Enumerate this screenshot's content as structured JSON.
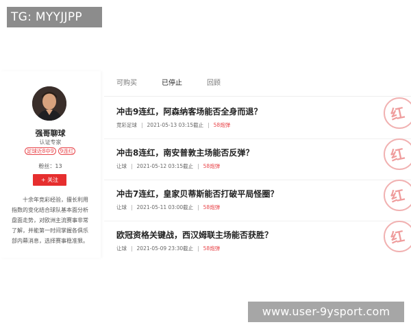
{
  "watermarks": {
    "top_left": "TG: MYYJJPP",
    "bottom_right": "www.user-9ysport.com"
  },
  "author": {
    "name": "强哥聊球",
    "title": "认证专家",
    "tags": [
      "足球近8中9",
      "9连红"
    ],
    "fans": "粉丝：13",
    "follow_label": "+ 关注",
    "bio": "十余年竞彩经验，擅长利用指数的变化结合球队基本面分析盘面走势，对欧洲主流赛事非常了解，并能第一时间掌握各俱乐部内幕消息，选择赛事稳准狠。"
  },
  "tabs": [
    "可购买",
    "已停止",
    "回顾"
  ],
  "active_tab": "已停止",
  "articles": [
    {
      "title": "冲击9连红，阿森纳客场能否全身而退？",
      "category": "竞彩足球",
      "time": "2021-05-13 03:15截止",
      "price": "58炮弹",
      "stamp": "红"
    },
    {
      "title": "冲击8连红，南安普敦主场能否反弹？",
      "category": "让球",
      "time": "2021-05-12 03:15截止",
      "price": "58炮弹",
      "stamp": "红"
    },
    {
      "title": "冲击7连红，皇家贝蒂斯能否打破平局怪圈？",
      "category": "让球",
      "time": "2021-05-11 03:00截止",
      "price": "58炮弹",
      "stamp": "红"
    },
    {
      "title": "欧冠资格关键战，西汉姆联主场能否获胜？",
      "category": "让球",
      "time": "2021-05-09 23:30截止",
      "price": "58炮弹",
      "stamp": "红"
    }
  ],
  "meta_separator": "|",
  "colors": {
    "accent": "#e62e2e",
    "tag_red": "#e8454a",
    "stamp_red": "#ef9d9d"
  }
}
